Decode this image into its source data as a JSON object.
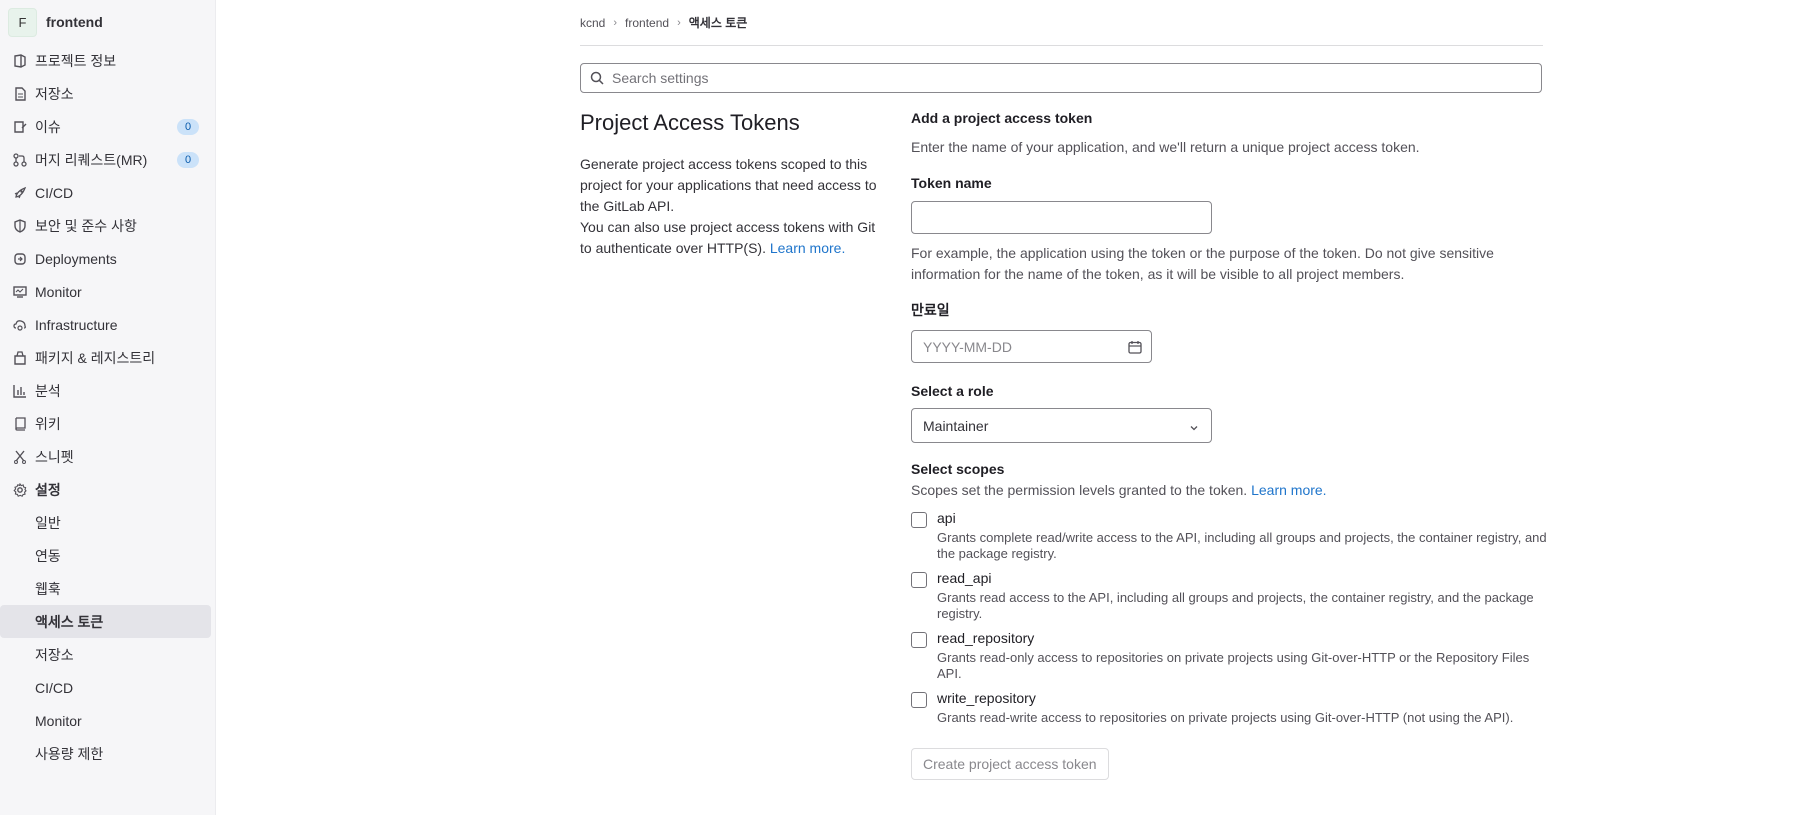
{
  "sidebar": {
    "project_initial": "F",
    "project_name": "frontend",
    "items": [
      {
        "label": "프로젝트 정보",
        "icon": "project-info-icon"
      },
      {
        "label": "저장소",
        "icon": "repository-icon"
      },
      {
        "label": "이슈",
        "icon": "issues-icon",
        "badge": "0"
      },
      {
        "label": "머지 리퀘스트(MR)",
        "icon": "merge-request-icon",
        "badge": "0"
      },
      {
        "label": "CI/CD",
        "icon": "rocket-icon"
      },
      {
        "label": "보안 및 준수 사항",
        "icon": "shield-icon"
      },
      {
        "label": "Deployments",
        "icon": "deployments-icon"
      },
      {
        "label": "Monitor",
        "icon": "monitor-icon"
      },
      {
        "label": "Infrastructure",
        "icon": "cloud-gear-icon"
      },
      {
        "label": "패키지 & 레지스트리",
        "icon": "package-icon"
      },
      {
        "label": "분석",
        "icon": "chart-icon"
      },
      {
        "label": "위키",
        "icon": "book-icon"
      },
      {
        "label": "스니펫",
        "icon": "snippet-icon"
      },
      {
        "label": "설정",
        "icon": "gear-icon"
      }
    ],
    "settings_sub": [
      {
        "label": "일반"
      },
      {
        "label": "연동"
      },
      {
        "label": "웹훅"
      },
      {
        "label": "액세스 토큰",
        "active": true
      },
      {
        "label": "저장소"
      },
      {
        "label": "CI/CD"
      },
      {
        "label": "Monitor"
      },
      {
        "label": "사용량 제한"
      }
    ]
  },
  "breadcrumb": [
    "kcnd",
    "frontend",
    "액세스 토큰"
  ],
  "search": {
    "placeholder": "Search settings"
  },
  "intro": {
    "title": "Project Access Tokens",
    "desc1": "Generate project access tokens scoped to this project for your applications that need access to the GitLab API.",
    "desc2": "You can also use project access tokens with Git to authenticate over HTTP(S).",
    "learn_more": "Learn more."
  },
  "form": {
    "heading": "Add a project access token",
    "subtext": "Enter the name of your application, and we'll return a unique project access token.",
    "token_name_label": "Token name",
    "token_name_value": "",
    "token_name_help": "For example, the application using the token or the purpose of the token. Do not give sensitive information for the name of the token, as it will be visible to all project members.",
    "expiry_label": "만료일",
    "expiry_placeholder": "YYYY-MM-DD",
    "role_label": "Select a role",
    "role_value": "Maintainer",
    "scopes_label": "Select scopes",
    "scopes_help": "Scopes set the permission levels granted to the token.",
    "scopes_learn_more": "Learn more.",
    "scopes": [
      {
        "name": "api",
        "desc": "Grants complete read/write access to the API, including all groups and projects, the container registry, and the package registry.",
        "checked": false
      },
      {
        "name": "read_api",
        "desc": "Grants read access to the API, including all groups and projects, the container registry, and the package registry.",
        "checked": false
      },
      {
        "name": "read_repository",
        "desc": "Grants read-only access to repositories on private projects using Git-over-HTTP or the Repository Files API.",
        "checked": false
      },
      {
        "name": "write_repository",
        "desc": "Grants read-write access to repositories on private projects using Git-over-HTTP (not using the API).",
        "checked": false
      }
    ],
    "submit_label": "Create project access token"
  }
}
